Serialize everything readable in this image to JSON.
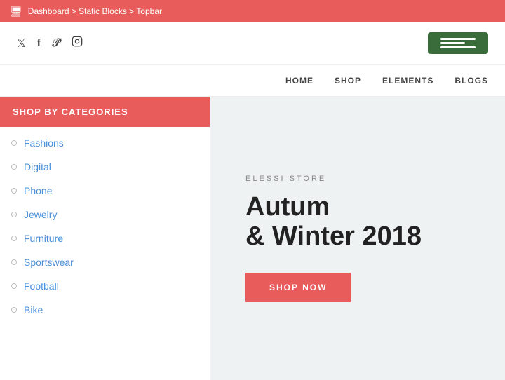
{
  "adminBar": {
    "icon": "🖥",
    "breadcrumb": "Dashboard > Static Blocks > Topbar"
  },
  "socialIcons": [
    {
      "name": "twitter",
      "glyph": "𝕏",
      "label": "Twitter"
    },
    {
      "name": "facebook",
      "glyph": "f",
      "label": "Facebook"
    },
    {
      "name": "pinterest",
      "glyph": "𝓟",
      "label": "Pinterest"
    },
    {
      "name": "instagram",
      "glyph": "◻",
      "label": "Instagram"
    }
  ],
  "nav": {
    "items": [
      {
        "label": "HOME"
      },
      {
        "label": "SHOP"
      },
      {
        "label": "ELEMENTS"
      },
      {
        "label": "BLOGS"
      }
    ]
  },
  "sidebar": {
    "header": "SHOP BY CATEGORIES",
    "categories": [
      {
        "label": "Fashions"
      },
      {
        "label": "Digital"
      },
      {
        "label": "Phone"
      },
      {
        "label": "Jewelry"
      },
      {
        "label": "Furniture"
      },
      {
        "label": "Sportswear"
      },
      {
        "label": "Football"
      },
      {
        "label": "Bike"
      }
    ]
  },
  "hero": {
    "store_label": "ELESSI STORE",
    "title_line1": "Autum",
    "title_line2": "& Winter 2018",
    "shop_now": "SHOP NOW"
  }
}
